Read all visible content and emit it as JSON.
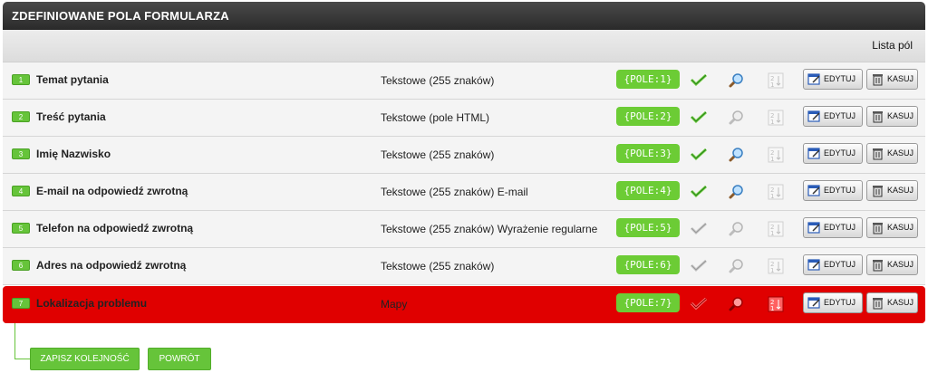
{
  "header": {
    "title": "ZDEFINIOWANE POLA FORMULARZA",
    "list_label": "Lista pól"
  },
  "colors": {
    "accent_green": "#66c43a",
    "highlight_red": "#e00000",
    "header_dark": "#333333"
  },
  "rows": [
    {
      "num": "1",
      "name": "Temat pytania",
      "type": "Tekstowe (255 znaków)",
      "tag": "{POLE:1}",
      "required": true,
      "searchable": true
    },
    {
      "num": "2",
      "name": "Treść pytania",
      "type": "Tekstowe (pole HTML)",
      "tag": "{POLE:2}",
      "required": true,
      "searchable": false
    },
    {
      "num": "3",
      "name": "Imię Nazwisko",
      "type": "Tekstowe (255 znaków)",
      "tag": "{POLE:3}",
      "required": true,
      "searchable": true
    },
    {
      "num": "4",
      "name": "E-mail na odpowiedź zwrotną",
      "type": "Tekstowe (255 znaków) E-mail",
      "tag": "{POLE:4}",
      "required": true,
      "searchable": true
    },
    {
      "num": "5",
      "name": "Telefon na odpowiedź zwrotną",
      "type": "Tekstowe (255 znaków) Wyrażenie regularne",
      "tag": "{POLE:5}",
      "required": false,
      "searchable": false
    },
    {
      "num": "6",
      "name": "Adres na odpowiedź zwrotną",
      "type": "Tekstowe (255 znaków)",
      "tag": "{POLE:6}",
      "required": false,
      "searchable": false
    },
    {
      "num": "7",
      "name": "Lokalizacja problemu",
      "type": "Mapy",
      "tag": "{POLE:7}",
      "required": false,
      "searchable": false,
      "highlighted": true
    }
  ],
  "row_buttons": {
    "edit_label": "EDYTUJ",
    "delete_label": "KASUJ"
  },
  "footer": {
    "save_order_label": "ZAPISZ KOLEJNOŚĆ",
    "back_label": "POWRÓT"
  }
}
